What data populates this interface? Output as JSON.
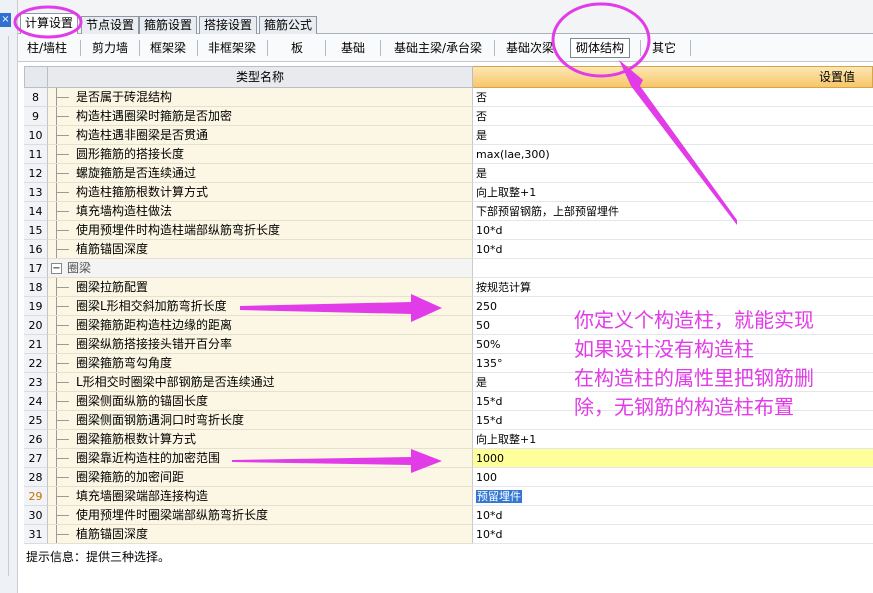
{
  "top_tabs": [
    "计算设置",
    "节点设置",
    "箍筋设置",
    "搭接设置",
    "箍筋公式"
  ],
  "sub_tabs": [
    "柱/墙柱",
    "剪力墙",
    "框架梁",
    "非框架梁",
    "板",
    "基础",
    "基础主梁/承台梁",
    "基础次梁",
    "砌体结构",
    "其它"
  ],
  "grid": {
    "col_name": "类型名称",
    "col_value": "设置值",
    "rows": [
      {
        "num": "8",
        "name": "是否属于砖混结构",
        "value": "否"
      },
      {
        "num": "9",
        "name": "构造柱遇圈梁时箍筋是否加密",
        "value": "否"
      },
      {
        "num": "10",
        "name": "构造柱遇非圈梁是否贯通",
        "value": "是"
      },
      {
        "num": "11",
        "name": "圆形箍筋的搭接长度",
        "value": "max(lae,300)"
      },
      {
        "num": "12",
        "name": "螺旋箍筋是否连续通过",
        "value": "是"
      },
      {
        "num": "13",
        "name": "构造柱箍筋根数计算方式",
        "value": "向上取整+1"
      },
      {
        "num": "14",
        "name": "填充墙构造柱做法",
        "value": "下部预留钢筋，上部预留埋件"
      },
      {
        "num": "15",
        "name": "使用预埋件时构造柱端部纵筋弯折长度",
        "value": "10*d"
      },
      {
        "num": "16",
        "name": "植筋锚固深度",
        "value": "10*d"
      },
      {
        "num": "17",
        "name": "圈梁",
        "value": "",
        "group": true
      },
      {
        "num": "18",
        "name": "圈梁拉筋配置",
        "value": "按规范计算"
      },
      {
        "num": "19",
        "name": "圈梁L形相交斜加筋弯折长度",
        "value": "250"
      },
      {
        "num": "20",
        "name": "圈梁箍筋距构造柱边缘的距离",
        "value": "50"
      },
      {
        "num": "21",
        "name": "圈梁纵筋搭接接头错开百分率",
        "value": "50%"
      },
      {
        "num": "22",
        "name": "圈梁箍筋弯勾角度",
        "value": "135°"
      },
      {
        "num": "23",
        "name": "L形相交时圈梁中部钢筋是否连续通过",
        "value": "是"
      },
      {
        "num": "24",
        "name": "圈梁侧面纵筋的锚固长度",
        "value": "15*d"
      },
      {
        "num": "25",
        "name": "圈梁侧面钢筋遇洞口时弯折长度",
        "value": "15*d"
      },
      {
        "num": "26",
        "name": "圈梁箍筋根数计算方式",
        "value": "向上取整+1"
      },
      {
        "num": "27",
        "name": "圈梁靠近构造柱的加密范围",
        "value": "1000",
        "highlight": true
      },
      {
        "num": "28",
        "name": "圈梁箍筋的加密间距",
        "value": "100"
      },
      {
        "num": "29",
        "name": "填充墙圈梁端部连接构造",
        "value": "预留埋件",
        "current": true
      },
      {
        "num": "30",
        "name": "使用预埋件时圈梁端部纵筋弯折长度",
        "value": "10*d"
      },
      {
        "num": "31",
        "name": "植筋锚固深度",
        "value": "10*d"
      }
    ]
  },
  "hint": "提示信息：提供三种选择。",
  "annotation": {
    "lines": [
      "你定义个构造柱，就能实现",
      "如果设计没有构造柱",
      "在构造柱的属性里把钢筋删",
      "除，无钢筋的构造柱布置"
    ],
    "color": "#e23be8"
  },
  "icons": {
    "close": "×"
  }
}
